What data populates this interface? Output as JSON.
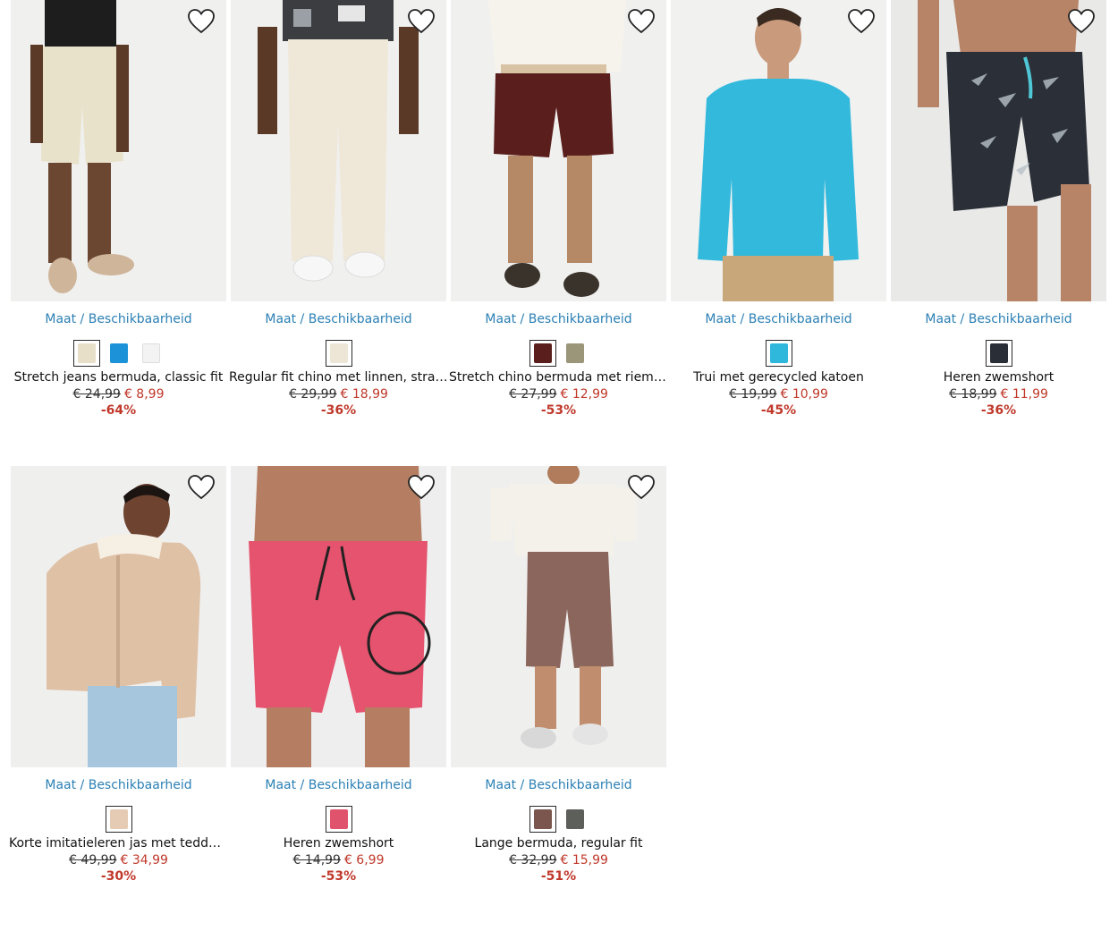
{
  "common": {
    "maat_label": "Maat",
    "separator": "/",
    "beschikbaarheid_label": "Beschikbaarheid"
  },
  "products": [
    {
      "name": "Stretch jeans bermuda, classic fit",
      "old_price": "€ 24,99",
      "new_price": "€ 8,99",
      "discount": "-64%",
      "swatches": [
        "#e7dfc8",
        "#1c93d8",
        "#f3f3f3"
      ]
    },
    {
      "name": "Regular fit chino met linnen, straight",
      "old_price": "€ 29,99",
      "new_price": "€ 18,99",
      "discount": "-36%",
      "swatches": [
        "#ede6d6"
      ]
    },
    {
      "name": "Stretch chino bermuda met riem, regular fit",
      "old_price": "€ 27,99",
      "new_price": "€ 12,99",
      "discount": "-53%",
      "swatches": [
        "#5a1f1c",
        "#9b957a"
      ]
    },
    {
      "name": "Trui met gerecycled katoen",
      "old_price": "€ 19,99",
      "new_price": "€ 10,99",
      "discount": "-45%",
      "swatches": [
        "#2fb8dc"
      ]
    },
    {
      "name": "Heren zwemshort",
      "old_price": "€ 18,99",
      "new_price": "€ 11,99",
      "discount": "-36%",
      "swatches": [
        "#2a2e36"
      ]
    },
    {
      "name": "Korte imitatieleren jas met teddy voering",
      "old_price": "€ 49,99",
      "new_price": "€ 34,99",
      "discount": "-30%",
      "swatches": [
        "#e5cbb3"
      ]
    },
    {
      "name": "Heren zwemshort",
      "old_price": "€ 14,99",
      "new_price": "€ 6,99",
      "discount": "-53%",
      "swatches": [
        "#e0536c"
      ]
    },
    {
      "name": "Lange bermuda, regular fit",
      "old_price": "€ 32,99",
      "new_price": "€ 15,99",
      "discount": "-51%",
      "swatches": [
        "#7a564e",
        "#5d5f5b"
      ]
    }
  ]
}
